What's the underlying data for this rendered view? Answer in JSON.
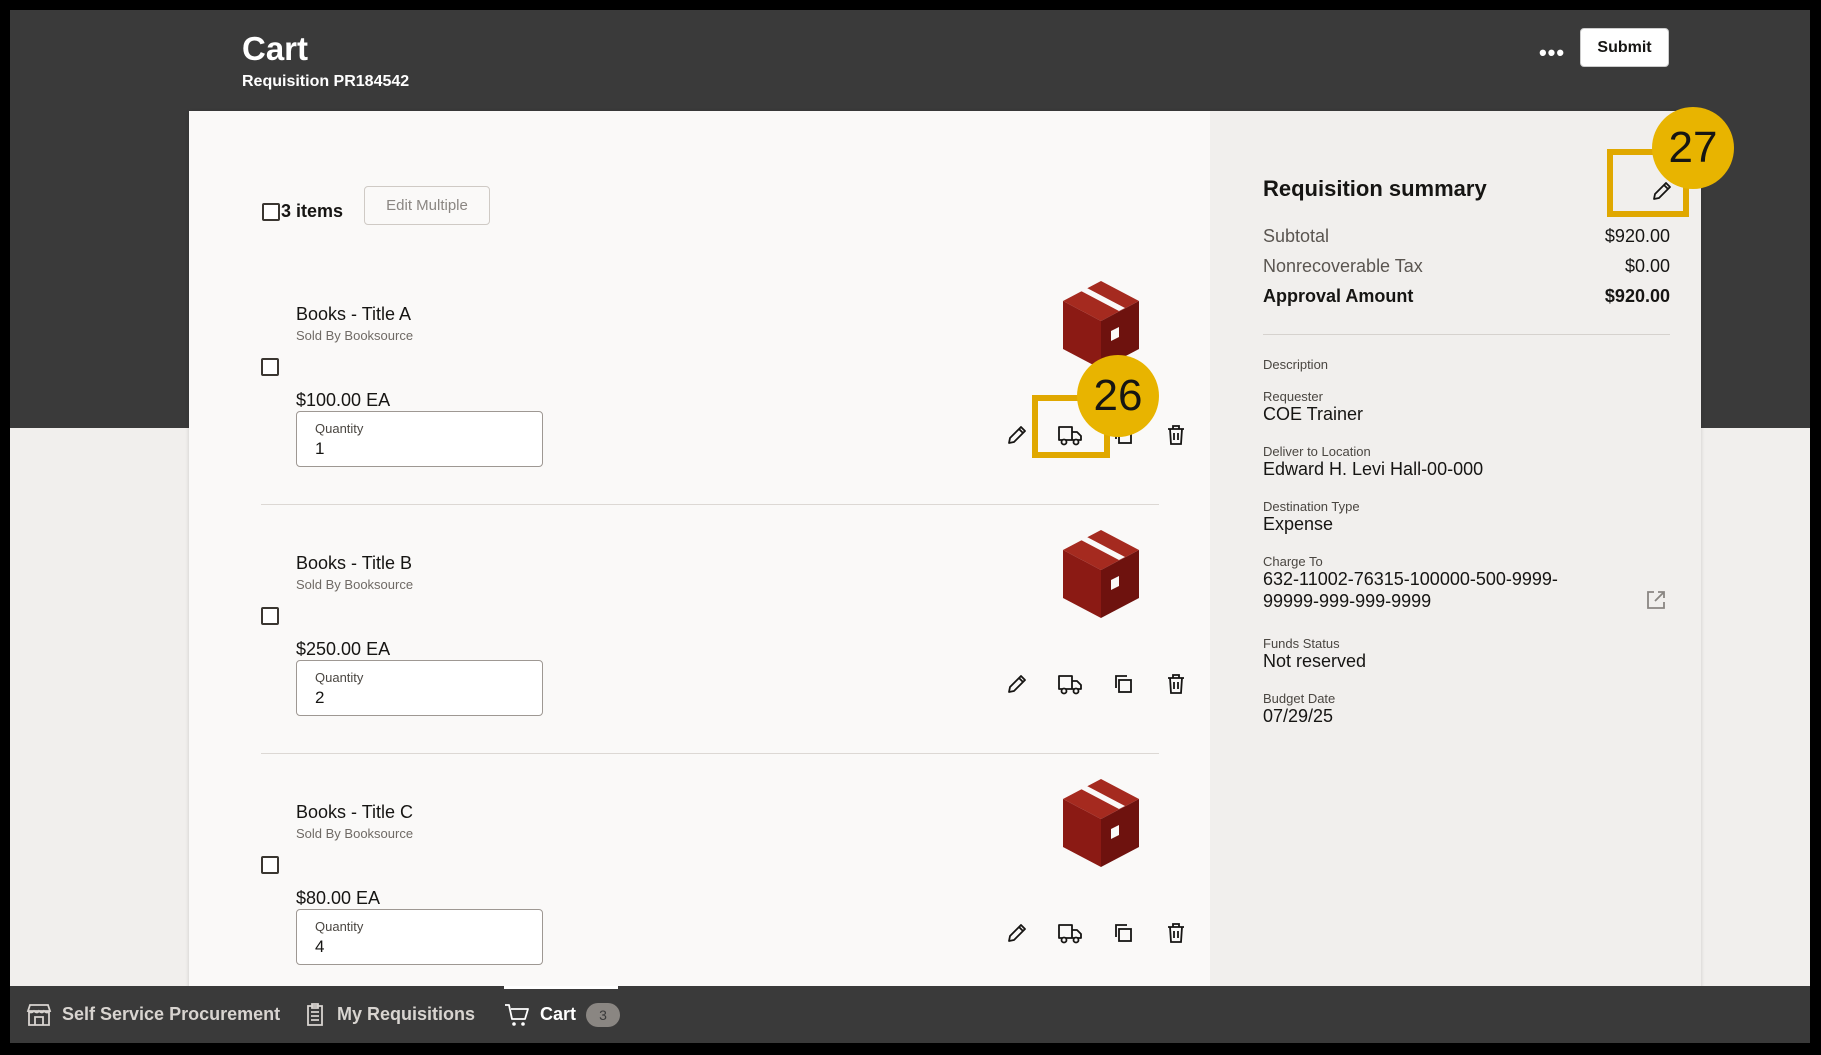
{
  "header": {
    "title": "Cart",
    "subtitle": "Requisition PR184542",
    "more_label": "•••",
    "submit_label": "Submit"
  },
  "cart": {
    "items_count": "3 items",
    "edit_multiple_label": "Edit Multiple",
    "items": [
      {
        "name": "Books - Title A",
        "seller": "Sold By Booksource",
        "price": "$100.00 EA",
        "qty_label": "Quantity",
        "qty": "1"
      },
      {
        "name": "Books - Title B",
        "seller": "Sold By Booksource",
        "price": "$250.00 EA",
        "qty_label": "Quantity",
        "qty": "2"
      },
      {
        "name": "Books - Title C",
        "seller": "Sold By Booksource",
        "price": "$80.00 EA",
        "qty_label": "Quantity",
        "qty": "4"
      }
    ],
    "item_icon": "package-box-icon",
    "item_actions": [
      "edit-icon",
      "truck-icon",
      "duplicate-icon",
      "trash-icon"
    ]
  },
  "summary": {
    "title": "Requisition summary",
    "rows": [
      {
        "label": "Subtotal",
        "value": "$920.00"
      },
      {
        "label": "Nonrecoverable Tax",
        "value": "$0.00"
      },
      {
        "label": "Approval Amount",
        "value": "$920.00"
      }
    ],
    "description_label": "Description",
    "requester_label": "Requester",
    "requester": "COE Trainer",
    "deliver_label": "Deliver to Location",
    "deliver": "Edward H. Levi Hall-00-000",
    "destination_label": "Destination Type",
    "destination": "Expense",
    "charge_label": "Charge To",
    "charge_line1": "632-11002-76315-100000-500-9999-",
    "charge_line2": "99999-999-999-9999",
    "funds_label": "Funds Status",
    "funds": "Not reserved",
    "budget_label": "Budget Date",
    "budget": "07/29/25"
  },
  "callouts": {
    "a": "26",
    "b": "27",
    "color": "#e8b400"
  },
  "bottom_nav": {
    "items": [
      {
        "label": "Self Service Procurement",
        "icon": "store-icon"
      },
      {
        "label": "My Requisitions",
        "icon": "clipboard-list-icon"
      },
      {
        "label": "Cart",
        "icon": "cart-icon",
        "badge": "3"
      }
    ]
  },
  "colors": {
    "header_bg": "#3a3a3a",
    "box_icon": "#8b1a14",
    "callout": "#e8b400"
  }
}
